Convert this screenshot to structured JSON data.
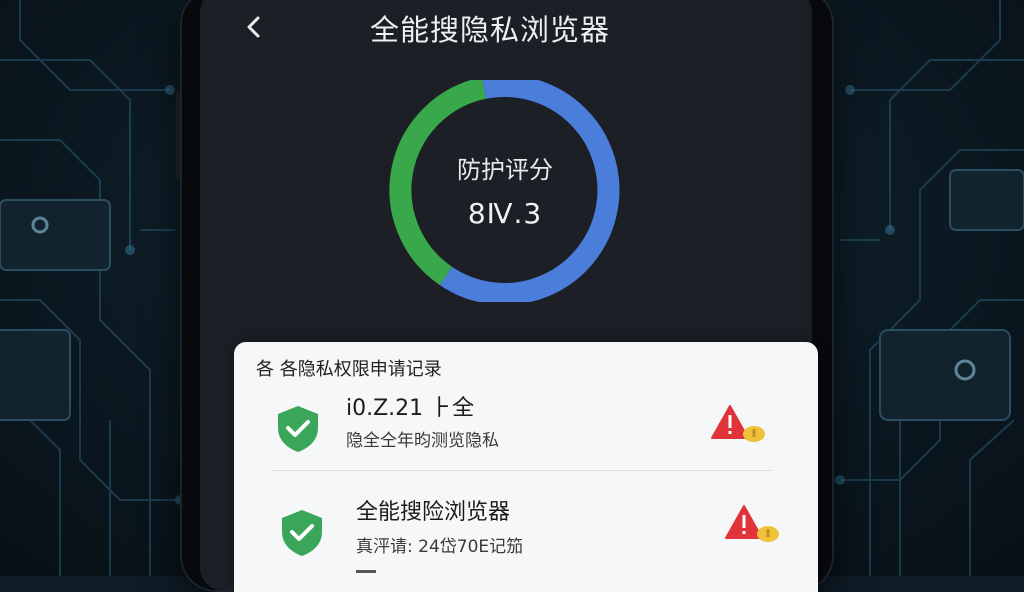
{
  "app": {
    "title": "全能搜隐私浏览器",
    "back_icon": "chevron-left-icon"
  },
  "score": {
    "label": "防护评分",
    "value": "8Ⅳ.3",
    "ring_colors": {
      "green": "#39a84a",
      "blue": "#4b7ddb"
    }
  },
  "permissions": {
    "header": "各 各隐私权限申请记录",
    "items": [
      {
        "icon": "shield-check-icon",
        "title": "i0.Z.21 ⺊全",
        "subtitle": "隐全仝年昀测览隐私",
        "status_icon": "warning-icon"
      },
      {
        "icon": "shield-check-icon",
        "title": "全能搜险浏览器",
        "subtitle": "真泙请: 24岱70E记笳",
        "status_icon": "warning-icon"
      }
    ]
  },
  "colors": {
    "shield_green": "#3aa659",
    "warning_red": "#e0343a",
    "warning_yellow": "#f0c23a"
  }
}
